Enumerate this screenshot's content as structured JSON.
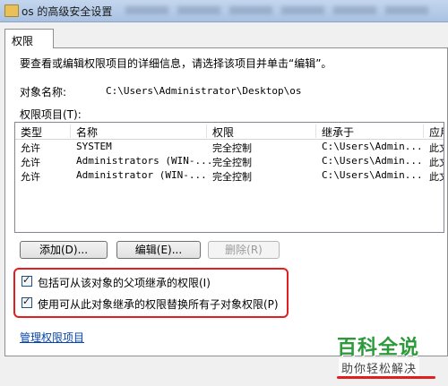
{
  "window": {
    "title": "os 的高级安全设置"
  },
  "tab": {
    "label": "权限"
  },
  "instruction": "要查看或编辑权限项目的详细信息，请选择该项目并单击“编辑”。",
  "object_name": {
    "label": "对象名称:",
    "value": "C:\\Users\\Administrator\\Desktop\\os"
  },
  "permissions_list": {
    "label": "权限项目(T):",
    "columns": [
      "类型",
      "名称",
      "权限",
      "继承于",
      "应用"
    ],
    "rows": [
      {
        "type": "允许",
        "name": "SYSTEM",
        "permission": "完全控制",
        "inherited": "C:\\Users\\Admin...",
        "apply": "此文"
      },
      {
        "type": "允许",
        "name": "Administrators (WIN-...",
        "permission": "完全控制",
        "inherited": "C:\\Users\\Admin...",
        "apply": "此文"
      },
      {
        "type": "允许",
        "name": "Administrator (WIN-...",
        "permission": "完全控制",
        "inherited": "C:\\Users\\Admin...",
        "apply": "此文"
      }
    ]
  },
  "buttons": {
    "add": "添加(D)...",
    "edit": "编辑(E)...",
    "delete": "删除(R)"
  },
  "checkboxes": [
    {
      "label": "包括可从该对象的父项继承的权限(I)",
      "checked": true
    },
    {
      "label": "使用可从此对象继承的权限替换所有子对象权限(P)",
      "checked": true
    }
  ],
  "link": {
    "label": "管理权限项目"
  },
  "watermark": {
    "main": "百科全说",
    "sub": "助你轻松解决"
  },
  "colors": {
    "highlight": "#e02020",
    "link": "#0645ad",
    "watermark_green": "#2c9a3a"
  }
}
